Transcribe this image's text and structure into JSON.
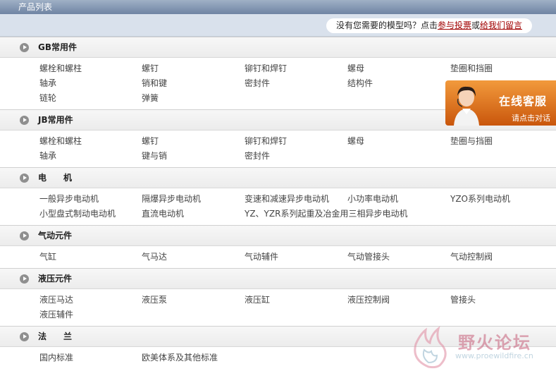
{
  "title_bar": {
    "label": "产品列表"
  },
  "notice": {
    "prefix": "没有您需要的模型吗？点击",
    "link1": "参与投票",
    "middle": "或",
    "link2": "给我们留言"
  },
  "sections": [
    {
      "title": "GB常用件",
      "rows": [
        [
          "螺栓和螺柱",
          "螺钉",
          "铆钉和焊钉",
          "螺母",
          "垫圈和挡圈"
        ],
        [
          "轴承",
          "销和键",
          "密封件",
          "结构件",
          ""
        ],
        [
          "链轮",
          "弹簧",
          "",
          "",
          ""
        ]
      ]
    },
    {
      "title": "JB常用件",
      "rows": [
        [
          "螺栓和螺柱",
          "螺钉",
          "铆钉和焊钉",
          "螺母",
          "垫圈与挡圈"
        ],
        [
          "轴承",
          "键与销",
          "密封件",
          "",
          ""
        ]
      ]
    },
    {
      "title": "电　　机",
      "rows": [
        [
          "一般异步电动机",
          "隔爆异步电动机",
          "变速和减速异步电动机",
          "小功率电动机",
          "YZO系列电动机"
        ],
        [
          "小型盘式制动电动机",
          "直流电动机",
          "YZ、YZR系列起重及冶金用三相异步电动机",
          "",
          ""
        ]
      ]
    },
    {
      "title": "气动元件",
      "rows": [
        [
          "气缸",
          "气马达",
          "气动辅件",
          "气动管接头",
          "气动控制阀"
        ]
      ]
    },
    {
      "title": "液压元件",
      "rows": [
        [
          "液压马达",
          "液压泵",
          "液压缸",
          "液压控制阀",
          "管接头"
        ],
        [
          "液压辅件",
          "",
          "",
          "",
          ""
        ]
      ]
    },
    {
      "title": "法　　兰",
      "rows": [
        [
          "国内标准",
          "欧美体系及其他标准",
          "",
          "",
          ""
        ]
      ]
    }
  ],
  "customer_service": {
    "title": "在线客服",
    "subtitle": "请点击对话"
  },
  "watermark": {
    "text": "野火论坛",
    "url": "www.proewildfire.cn"
  },
  "colors": {
    "link": "#a00000",
    "cs_orange": "#e07a22",
    "header_blue": "#7d90ad"
  }
}
